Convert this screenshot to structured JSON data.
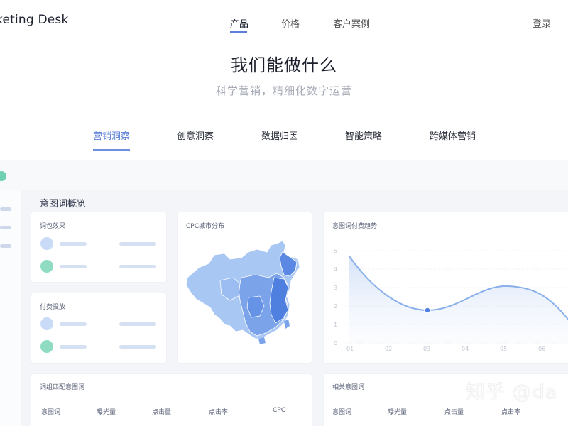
{
  "header": {
    "logo": "keting Desk",
    "nav": [
      "产品",
      "价格",
      "客户案例"
    ],
    "login": "登录"
  },
  "hero": {
    "title": "我们能做什么",
    "subtitle": "科学营销，精细化数字运营"
  },
  "tabs": [
    "营销洞察",
    "创意洞察",
    "数据归因",
    "智能策略",
    "跨媒体营销"
  ],
  "dashboard": {
    "section_title": "意图词概览",
    "card_keyword_effect": "词包效果",
    "card_paid_delivery": "付费投放",
    "card_map": "CPC城市分布",
    "card_trend": "意图词付费趋势",
    "trend_y_ticks": [
      "5",
      "4",
      "3",
      "2",
      "1",
      "0"
    ],
    "trend_x_ticks": [
      "01",
      "02",
      "03",
      "04",
      "05",
      "06"
    ],
    "card_match": "词组匹配意图词",
    "match_columns": [
      "意图词",
      "曝光量",
      "点击量",
      "点击率",
      "CPC"
    ],
    "card_related": "相关意图词",
    "related_columns": [
      "意图词",
      "曝光量",
      "点击量",
      "点击率"
    ]
  },
  "watermark": "知乎 @da",
  "colors": {
    "accent": "#5a7fd8",
    "map_light": "#a8c6f3",
    "map_dark": "#4d7fe0",
    "green": "#8fdcc2"
  }
}
